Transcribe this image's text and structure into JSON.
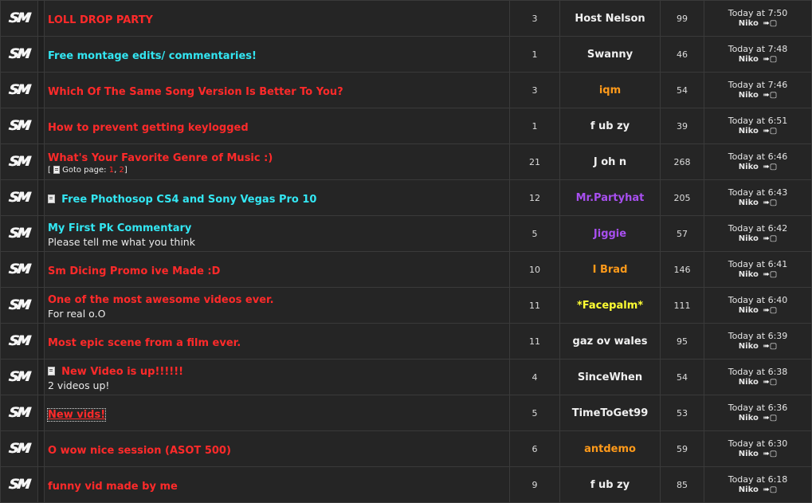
{
  "topics": [
    {
      "title": "LOLL DROP PARTY",
      "title_color": "red",
      "replies": "3",
      "author": "Host Nelson",
      "author_color": "white",
      "views": "99",
      "last_time": "Today at 7:50",
      "last_user": "Niko"
    },
    {
      "title": "Free montage edits/ commentaries!",
      "title_color": "cyan",
      "replies": "1",
      "author": "Swanny",
      "author_color": "white",
      "views": "46",
      "last_time": "Today at 7:48",
      "last_user": "Niko"
    },
    {
      "title": "Which Of The Same Song Version Is Better To You?",
      "title_color": "red",
      "replies": "3",
      "author": "iqm",
      "author_color": "orange",
      "views": "54",
      "last_time": "Today at 7:46",
      "last_user": "Niko"
    },
    {
      "title": "How to prevent getting keylogged",
      "title_color": "red",
      "replies": "1",
      "author": "f ub zy",
      "author_color": "white",
      "views": "39",
      "last_time": "Today at 6:51",
      "last_user": "Niko"
    },
    {
      "title": "What's Your Favorite Genre of Music :)",
      "title_color": "red",
      "goto": true,
      "replies": "21",
      "author": "J oh n",
      "author_color": "white",
      "views": "268",
      "last_time": "Today at 6:46",
      "last_user": "Niko"
    },
    {
      "title": "Free Phothosop CS4 and Sony Vegas Pro 10",
      "title_color": "cyan",
      "attachment": true,
      "replies": "12",
      "author": "Mr.Partyhat",
      "author_color": "purple",
      "views": "205",
      "last_time": "Today at 6:43",
      "last_user": "Niko"
    },
    {
      "title": "My First Pk Commentary",
      "title_color": "cyan",
      "subtitle": "Please tell me what you think",
      "replies": "5",
      "author": "Jiggie",
      "author_color": "purple",
      "views": "57",
      "last_time": "Today at 6:42",
      "last_user": "Niko"
    },
    {
      "title": "Sm Dicing Promo ive Made :D",
      "title_color": "red",
      "replies": "10",
      "author": "I Brad",
      "author_color": "orange",
      "views": "146",
      "last_time": "Today at 6:41",
      "last_user": "Niko"
    },
    {
      "title": "One of the most awesome videos ever.",
      "title_color": "red",
      "subtitle": "For real o.O",
      "replies": "11",
      "author": "*Facepalm*",
      "author_color": "yellow",
      "views": "111",
      "last_time": "Today at 6:40",
      "last_user": "Niko"
    },
    {
      "title": "Most epic scene from a film ever.",
      "title_color": "red",
      "replies": "11",
      "author": "gaz ov wales",
      "author_color": "white",
      "views": "95",
      "last_time": "Today at 6:39",
      "last_user": "Niko"
    },
    {
      "title": "New Video is up!!!!!!",
      "title_color": "red",
      "attachment": true,
      "subtitle": "2 videos up!",
      "replies": "4",
      "author": "SinceWhen",
      "author_color": "white",
      "views": "54",
      "last_time": "Today at 6:38",
      "last_user": "Niko"
    },
    {
      "title": "New vids!",
      "title_color": "red",
      "boxed": true,
      "replies": "5",
      "author": "TimeToGet99",
      "author_color": "white",
      "views": "53",
      "last_time": "Today at 6:36",
      "last_user": "Niko"
    },
    {
      "title": "O wow nice session (ASOT 500)",
      "title_color": "red",
      "replies": "6",
      "author": "antdemo",
      "author_color": "orange",
      "views": "59",
      "last_time": "Today at 6:30",
      "last_user": "Niko"
    },
    {
      "title": "funny vid made by me",
      "title_color": "red",
      "replies": "9",
      "author": "f ub zy",
      "author_color": "white",
      "views": "85",
      "last_time": "Today at 6:18",
      "last_user": "Niko"
    }
  ],
  "goto": {
    "prefix": "[",
    "label": "Goto page:",
    "pages": [
      "1",
      "2"
    ],
    "separator": ",",
    "suffix": "]"
  },
  "icons": {
    "topic_icon": "sm-logo-icon",
    "last_post_icon": "goto-last-post-icon",
    "attachment_icon": "attachment-icon"
  },
  "colors": {
    "red": "#ff2a2a",
    "cyan": "#33e6f2",
    "white": "#f0f0f0",
    "orange": "#ff9a1a",
    "purple": "#a84ff0",
    "yellow": "#ffff33"
  },
  "logo_text": "SM"
}
